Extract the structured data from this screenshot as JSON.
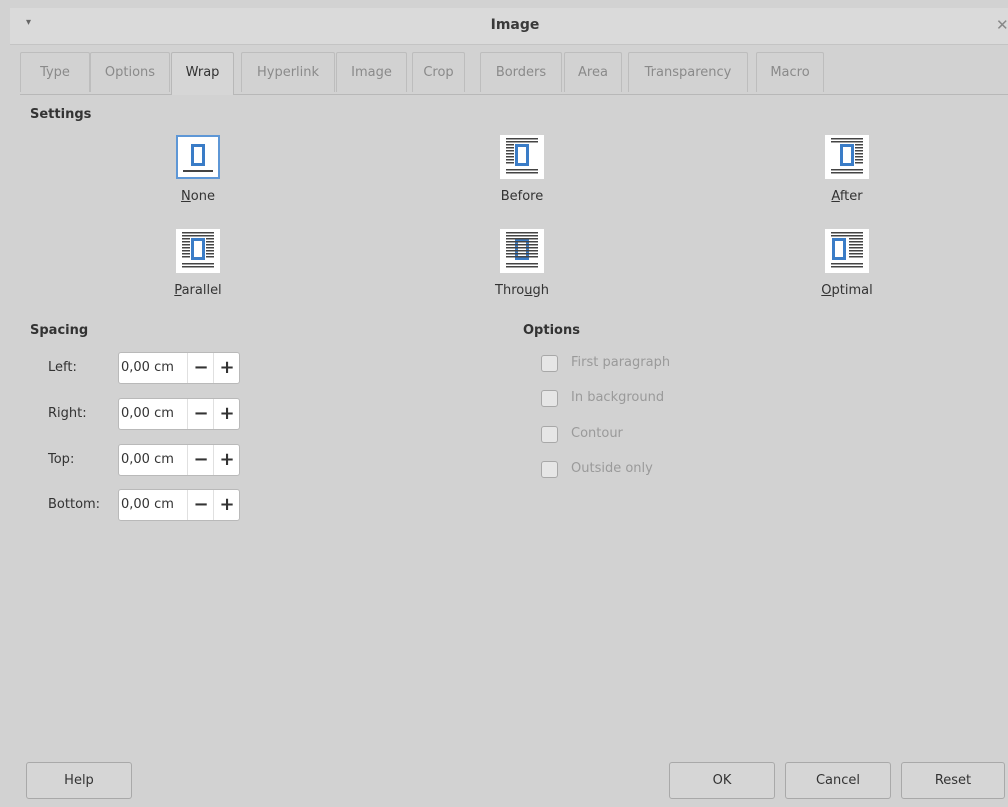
{
  "window": {
    "title": "Image",
    "menu_glyph": "▾",
    "close_glyph": "✕"
  },
  "tabs": [
    {
      "label": "Type"
    },
    {
      "label": "Options"
    },
    {
      "label": "Wrap"
    },
    {
      "label": "Hyperlink"
    },
    {
      "label": "Image"
    },
    {
      "label": "Crop"
    },
    {
      "label": "Borders"
    },
    {
      "label": "Area"
    },
    {
      "label": "Transparency"
    },
    {
      "label": "Macro"
    }
  ],
  "active_tab": "Wrap",
  "settings": {
    "title": "Settings",
    "selected": "None",
    "options": {
      "none": {
        "mnemonic": "N",
        "rest": "one"
      },
      "before": {
        "text": "Before"
      },
      "after": {
        "mnemonic": "A",
        "rest": "fter"
      },
      "parallel": {
        "mnemonic": "P",
        "rest": "arallel"
      },
      "through": {
        "pre": "Thro",
        "mnemonic": "u",
        "rest": "gh"
      },
      "optimal": {
        "mnemonic": "O",
        "rest": "ptimal"
      }
    }
  },
  "spacing": {
    "title": "Spacing",
    "left": {
      "label": "Left:",
      "value": "0,00 cm"
    },
    "right": {
      "label": "Right:",
      "value": "0,00 cm"
    },
    "top": {
      "label": "Top:",
      "value": "0,00 cm"
    },
    "bottom": {
      "label": "Bottom:",
      "value": "0,00 cm"
    },
    "minus_glyph": "−",
    "plus_glyph": "+"
  },
  "options": {
    "title": "Options",
    "first_paragraph": {
      "label": "First paragraph",
      "checked": false
    },
    "in_background": {
      "label": "In background",
      "checked": false
    },
    "contour": {
      "label": "Contour",
      "checked": false
    },
    "outside_only": {
      "label": "Outside only",
      "checked": false
    }
  },
  "buttons": {
    "help": "Help",
    "ok": "OK",
    "cancel": "Cancel",
    "reset": "Reset"
  },
  "colors": {
    "accent": "#5e97d6",
    "icon_blue": "#3a7cc7",
    "dialog_bg": "#d2d2d2"
  }
}
